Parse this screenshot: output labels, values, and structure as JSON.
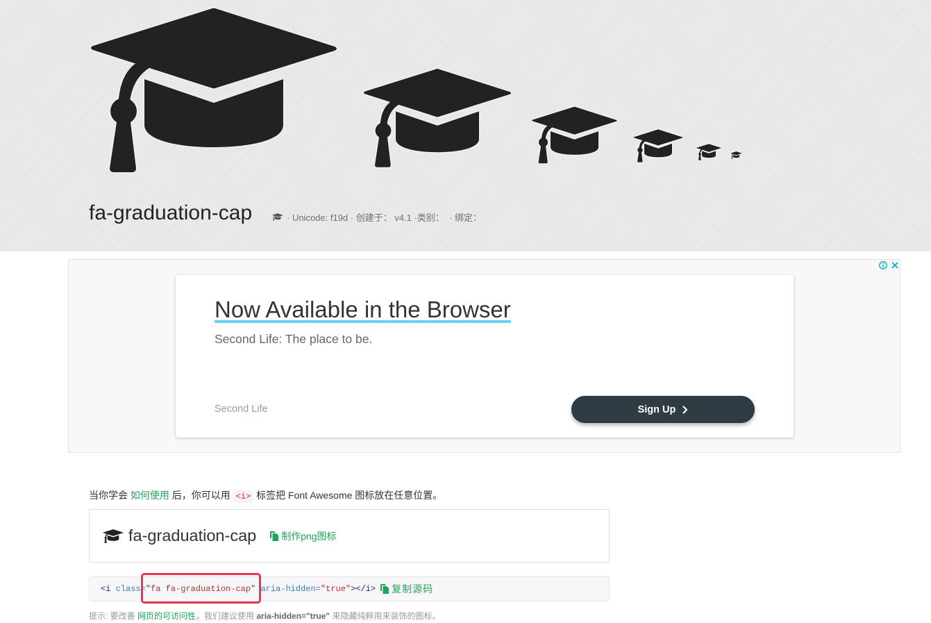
{
  "hero": {
    "title": "fa-graduation-cap",
    "meta_text": "· Unicode: f19d · 创建于： v4.1 ·类别：  · 绑定：",
    "icon": "graduation-cap-icon"
  },
  "ad": {
    "headline": "Now Available in the Browser",
    "subtitle": "Second Life: The place to be.",
    "advertiser": "Second Life",
    "cta_label": "Sign Up",
    "icons": {
      "info": "info-icon",
      "close": "close-icon",
      "cta": "chevron-right-icon"
    }
  },
  "usage": {
    "intro": {
      "before": "当你学会 ",
      "link": "如何使用",
      "middle": " 后，你可以用 ",
      "tag": "<i>",
      "after": " 标签把 Font Awesome 图标放在任意位置。"
    },
    "example": {
      "icon": "graduation-cap-icon",
      "label": "fa-graduation-cap",
      "make_png_label": "制作png图标",
      "make_png_icon": "copy-icon"
    },
    "code": {
      "tag_open": "<i",
      "attr_class": " class=",
      "value_class": "\"fa fa-graduation-cap\"",
      "attr_aria": " aria-hidden=",
      "value_aria": "\"true\"",
      "tag_close": "></i>",
      "copy_label": "复制源码",
      "copy_icon": "copy-icon"
    },
    "tip": {
      "before": "提示: 要改善 ",
      "link": "网页的可访问性",
      "middle": "，我们建议使用 ",
      "code": "aria-hidden=\"true\"",
      "after": " 来隐藏纯粹用来装饰的图标。"
    }
  },
  "colors": {
    "hero_background": "#e8e8e8",
    "icon": "#222222",
    "link_green": "#22a35a",
    "headline_underline": "#6ccff5",
    "cta_background": "#2f3c43",
    "ad_icons": "#00aecd",
    "highlight": "#e8384f",
    "code_tag": "#1f2a7c",
    "code_attr": "#3b7cb8",
    "code_value": "#b5322c"
  }
}
